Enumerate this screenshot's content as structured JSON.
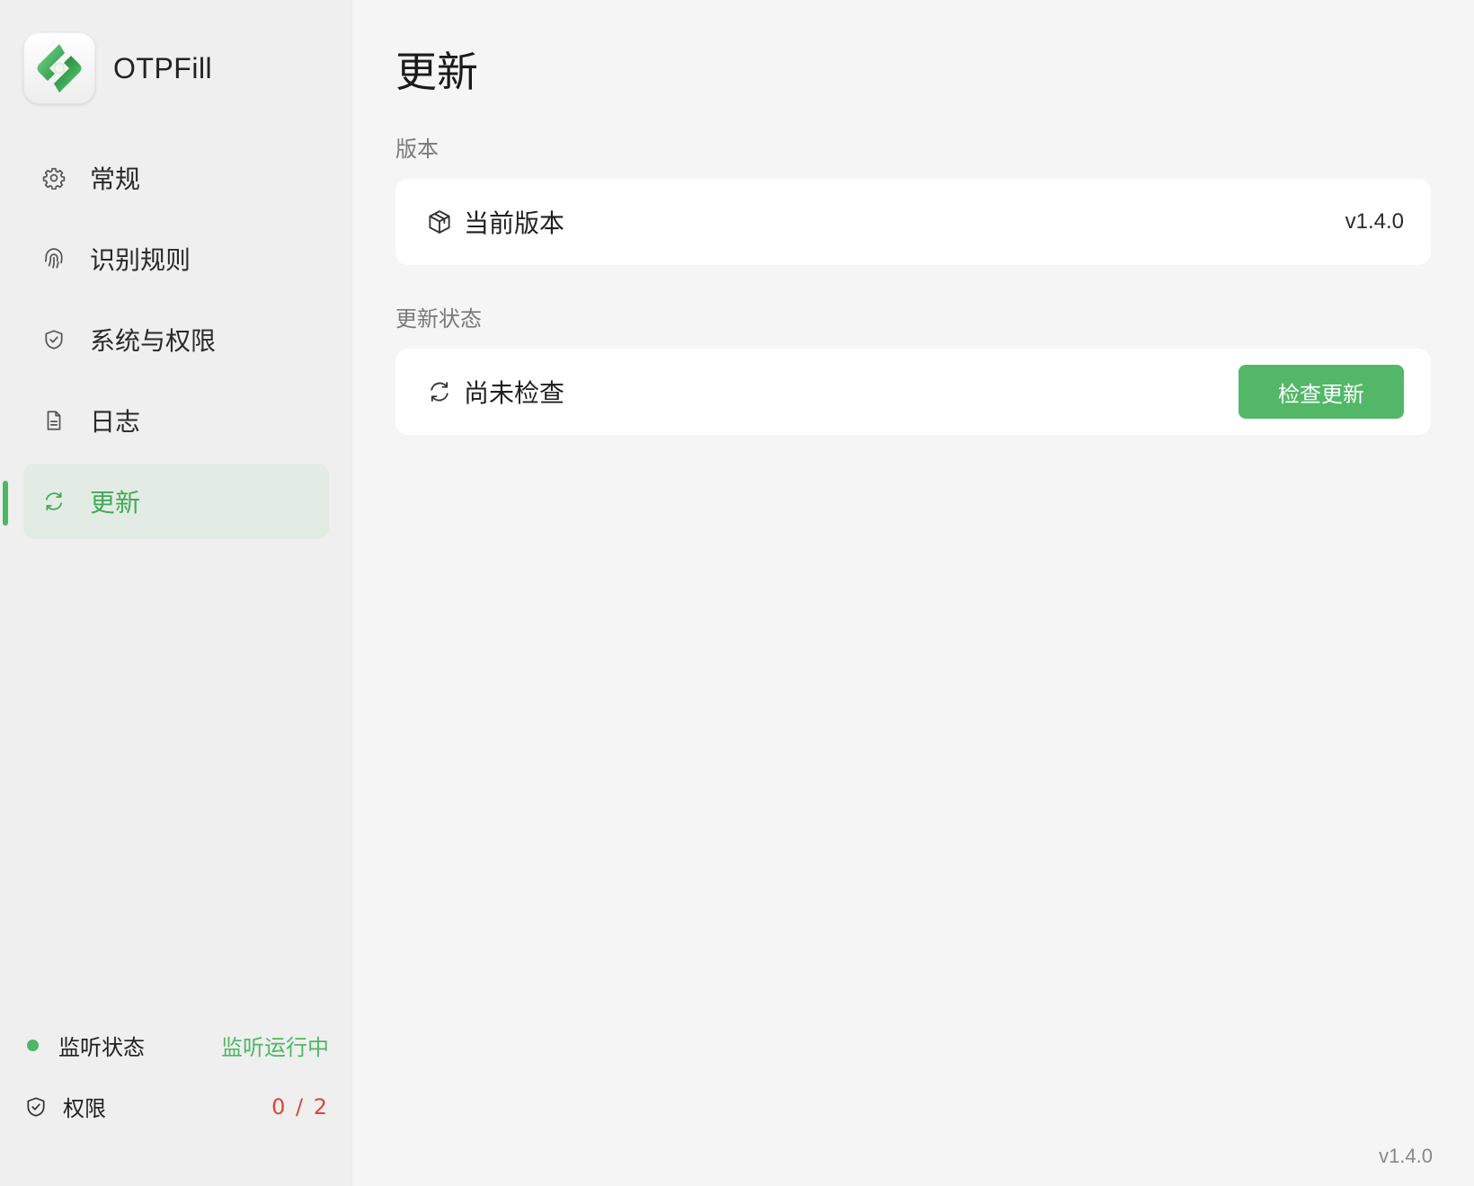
{
  "app": {
    "name": "OTPFill"
  },
  "sidebar": {
    "items": [
      {
        "label": "常规",
        "icon": "gear-icon"
      },
      {
        "label": "识别规则",
        "icon": "fingerprint-icon"
      },
      {
        "label": "系统与权限",
        "icon": "shield-icon"
      },
      {
        "label": "日志",
        "icon": "document-icon"
      },
      {
        "label": "更新",
        "icon": "refresh-icon",
        "active": true
      }
    ],
    "footer": {
      "listen_label": "监听状态",
      "listen_value": "监听运行中",
      "permission_label": "权限",
      "permission_value": "0 / 2"
    }
  },
  "main": {
    "title": "更新",
    "version_section": {
      "label": "版本",
      "current_label": "当前版本",
      "current_value": "v1.4.0"
    },
    "status_section": {
      "label": "更新状态",
      "status_text": "尚未检查",
      "check_button": "检查更新"
    },
    "footer_version": "v1.4.0"
  },
  "colors": {
    "accent": "#4cb865",
    "active_bg": "#e3ece4",
    "warning": "#e0453a"
  }
}
